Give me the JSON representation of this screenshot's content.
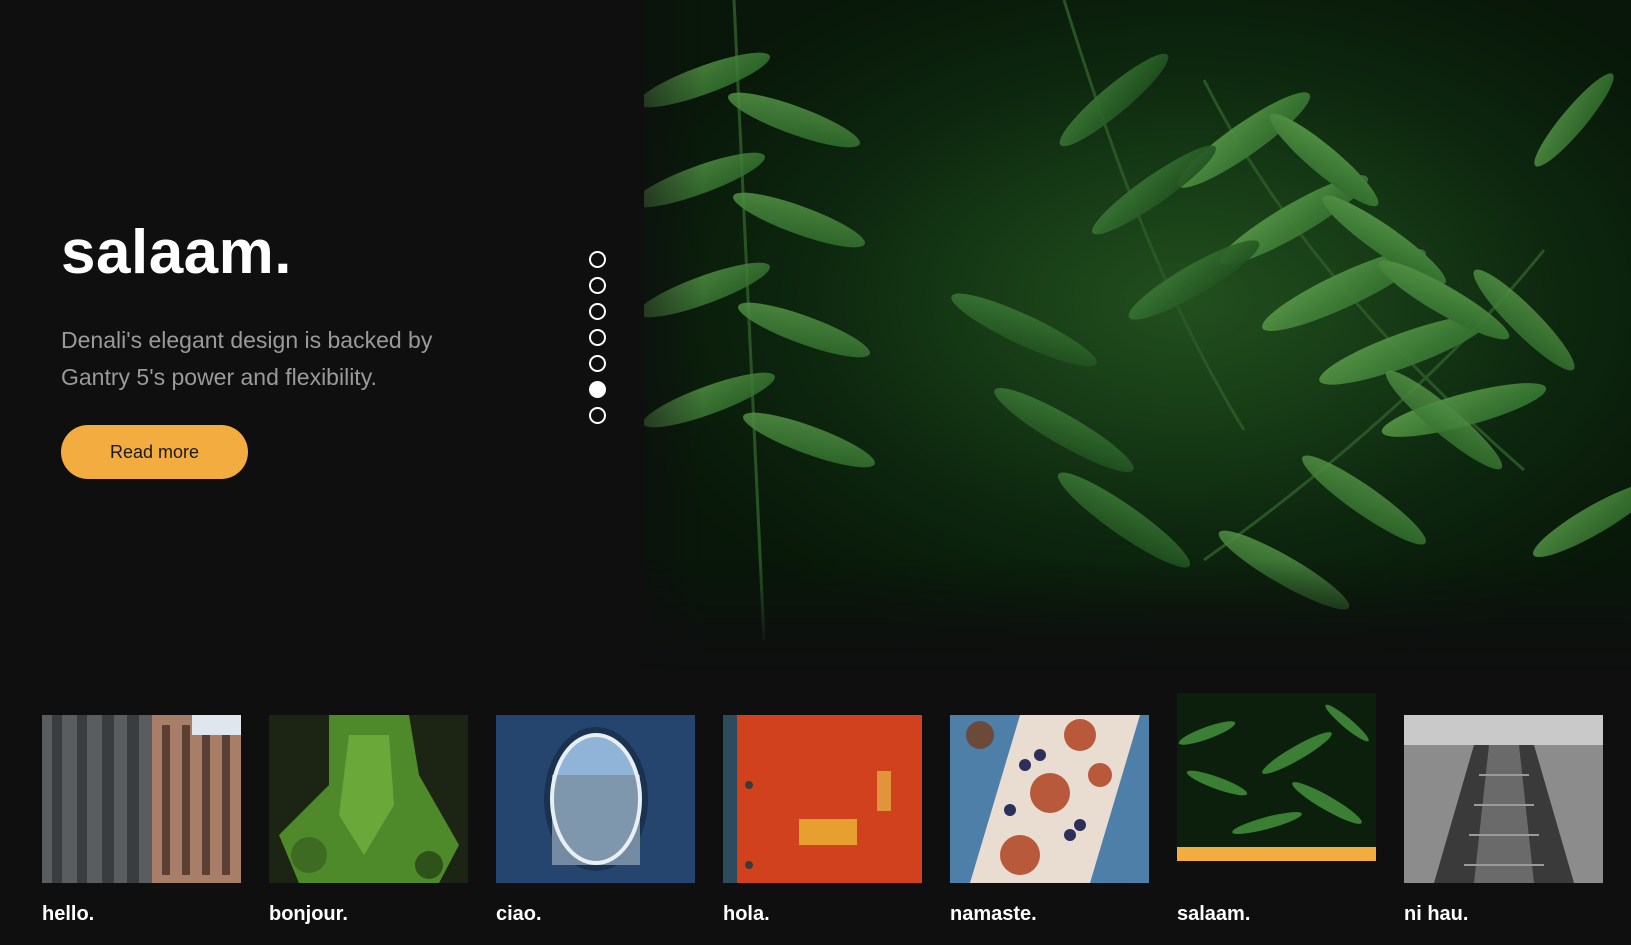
{
  "hero": {
    "title": "salaam.",
    "description": "Denali's elegant design is backed by Gantry 5's power and flexibility.",
    "button_label": "Read more",
    "image_icon": "fern-photo"
  },
  "pagination": {
    "count": 7,
    "active_index": 5
  },
  "thumbnails": [
    {
      "label": "hello.",
      "image": "building-facade-photo",
      "active": false
    },
    {
      "label": "bonjour.",
      "image": "mossy-tree-photo",
      "active": false
    },
    {
      "label": "ciao.",
      "image": "airplane-window-photo",
      "active": false
    },
    {
      "label": "hola.",
      "image": "red-door-photo",
      "active": false
    },
    {
      "label": "namaste.",
      "image": "fig-toast-photo",
      "active": false
    },
    {
      "label": "salaam.",
      "image": "fern-photo",
      "active": true
    },
    {
      "label": "ni hau.",
      "image": "escalator-photo",
      "active": false
    }
  ],
  "colors": {
    "background": "#0f0f10",
    "accent": "#f2ac3f",
    "text": "#ffffff",
    "muted_text": "#9a9a9a"
  }
}
